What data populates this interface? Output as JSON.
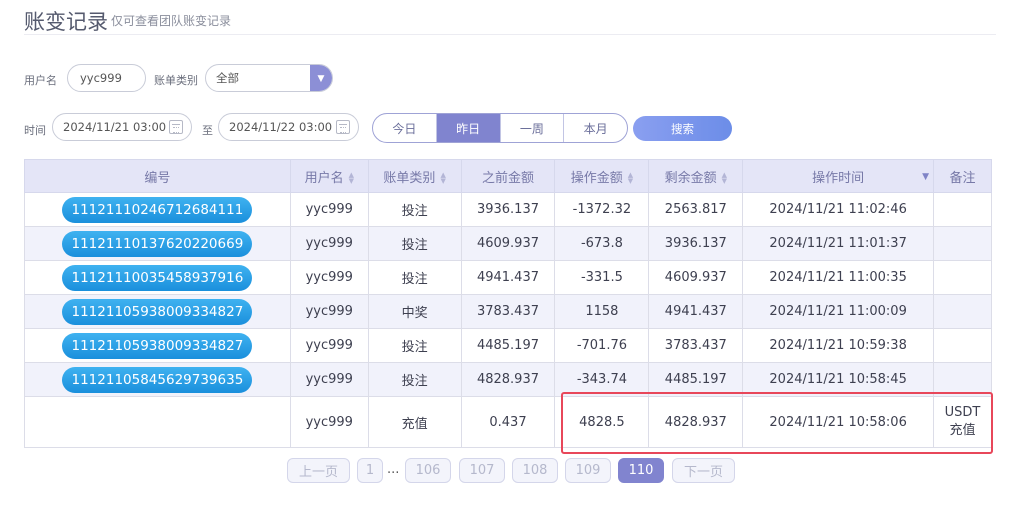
{
  "header": {
    "title": "账变记录",
    "subtitle": "仅可查看团队账变记录"
  },
  "filters": {
    "username_label": "用户名",
    "username_value": "yyc999",
    "category_label": "账单类别",
    "category_value": "全部",
    "time_label": "时间",
    "date_from": "2024/11/21 03:00",
    "to_label": "至",
    "date_to": "2024/11/22 03:00",
    "ranges": [
      "今日",
      "昨日",
      "一周",
      "本月"
    ],
    "active_range": "昨日",
    "search_label": "搜索"
  },
  "table": {
    "headers": [
      "编号",
      "用户名",
      "账单类别",
      "之前金额",
      "操作金额",
      "剩余金额",
      "操作时间",
      "备注"
    ],
    "rows": [
      {
        "id": "1112111024671268411​1",
        "user": "yyc999",
        "type": "投注",
        "before": "3936.137",
        "amount": "-1372.32",
        "after": "2563.817",
        "time": "2024/11/21 11:02:46",
        "note": ""
      },
      {
        "id": "11121110137620220669",
        "user": "yyc999",
        "type": "投注",
        "before": "4609.937",
        "amount": "-673.8",
        "after": "3936.137",
        "time": "2024/11/21 11:01:37",
        "note": ""
      },
      {
        "id": "11121110035458937916",
        "user": "yyc999",
        "type": "投注",
        "before": "4941.437",
        "amount": "-331.5",
        "after": "4609.937",
        "time": "2024/11/21 11:00:35",
        "note": ""
      },
      {
        "id": "1112110593800933482​7",
        "user": "yyc999",
        "type": "中奖",
        "before": "3783.437",
        "amount": "1158",
        "after": "4941.437",
        "time": "2024/11/21 11:00:09",
        "note": ""
      },
      {
        "id": "11121105938009334827",
        "user": "yyc999",
        "type": "投注",
        "before": "4485.197",
        "amount": "-701.76",
        "after": "3783.437",
        "time": "2024/11/21 10:59:38",
        "note": ""
      },
      {
        "id": "11121105845629739635",
        "user": "yyc999",
        "type": "投注",
        "before": "4828.937",
        "amount": "-343.74",
        "after": "4485.197",
        "time": "2024/11/21 10:58:45",
        "note": ""
      },
      {
        "id": "",
        "user": "yyc999",
        "type": "充值",
        "before": "0.437",
        "amount": "4828.5",
        "after": "4828.937",
        "time": "2024/11/21 10:58:06",
        "note": "USDT充值"
      }
    ]
  },
  "pagination": {
    "prev": "上一页",
    "first": "1",
    "ellipsis": "...",
    "pages": [
      "106",
      "107",
      "108",
      "109",
      "110"
    ],
    "current": "110",
    "next": "下一页"
  }
}
